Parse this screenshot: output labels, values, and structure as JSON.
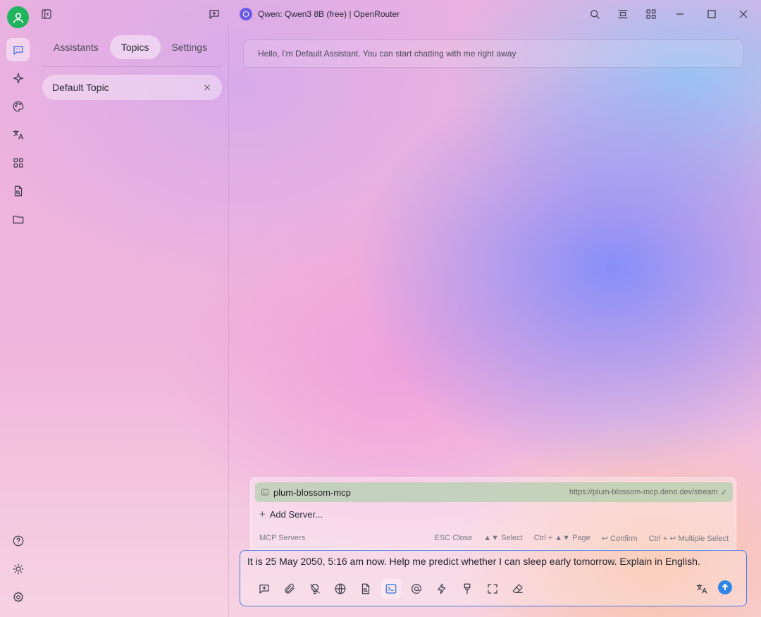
{
  "window": {
    "title": "Qwen: Qwen3 8B (free) | OpenRouter"
  },
  "sidebar": {
    "tabs": [
      "Assistants",
      "Topics",
      "Settings"
    ],
    "active_tab": "Topics",
    "topics": [
      {
        "label": "Default Topic"
      }
    ]
  },
  "chat": {
    "greeting": "Hello, I'm Default Assistant. You can start chatting with me right away"
  },
  "mcp_popup": {
    "server_name": "plum-blossom-mcp",
    "server_url": "https://plum-blossom-mcp.deno.dev/stream",
    "add_server": "Add Server...",
    "section_label": "MCP Servers",
    "hints": {
      "close": "ESC Close",
      "select": "▲▼ Select",
      "page": "Ctrl + ▲▼ Page",
      "confirm": "↩ Confirm",
      "multi": "Ctrl + ↩ Multiple Select"
    }
  },
  "input": {
    "value": "It is 25 May 2050, 5:16 am now. Help me predict whether I can sleep early tomorrow. Explain in English."
  },
  "colors": {
    "accent": "#2f6be0",
    "send": "#2f86e6",
    "avatar": "#22b35e",
    "server_selected": "#a8d0a8"
  }
}
